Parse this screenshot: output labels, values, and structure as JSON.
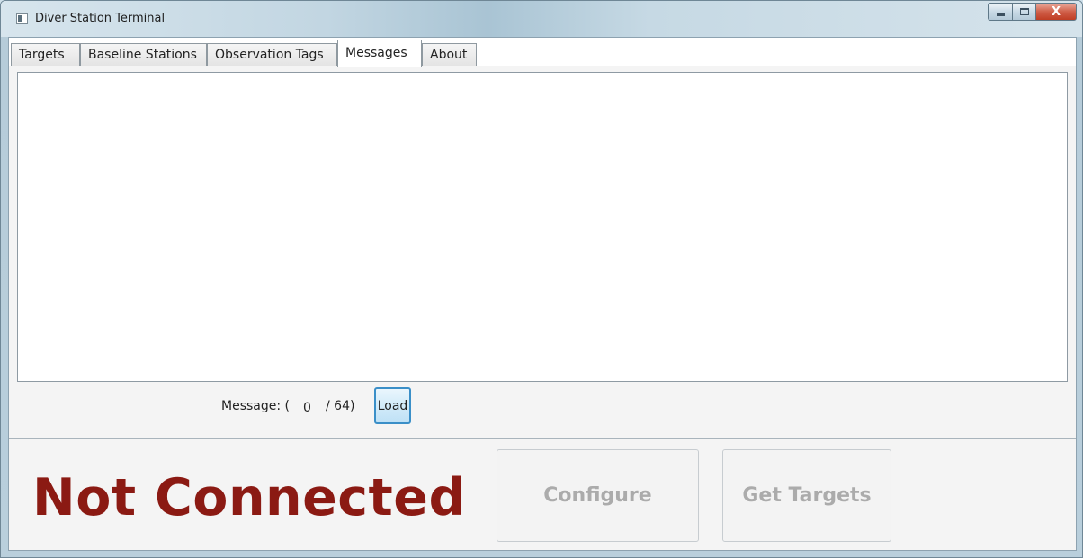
{
  "window": {
    "title": "Diver Station Terminal",
    "close_glyph": "X"
  },
  "tabs": [
    {
      "label": "Targets",
      "active": false
    },
    {
      "label": "Baseline Stations",
      "active": false
    },
    {
      "label": "Observation Tags",
      "active": false
    },
    {
      "label": "Messages",
      "active": true
    },
    {
      "label": "About",
      "active": false
    }
  ],
  "messages": {
    "area_text": "",
    "label": "Message: (",
    "count": "0",
    "separator": "/ 64)",
    "load_label": "Load"
  },
  "footer": {
    "status": "Not Connected",
    "status_color": "#8b1a13",
    "configure_label": "Configure",
    "get_targets_label": "Get Targets",
    "buttons_enabled": false
  },
  "icons": {
    "app": "app-window-icon",
    "minimize": "minimize-icon",
    "maximize": "maximize-icon",
    "close": "close-icon"
  }
}
